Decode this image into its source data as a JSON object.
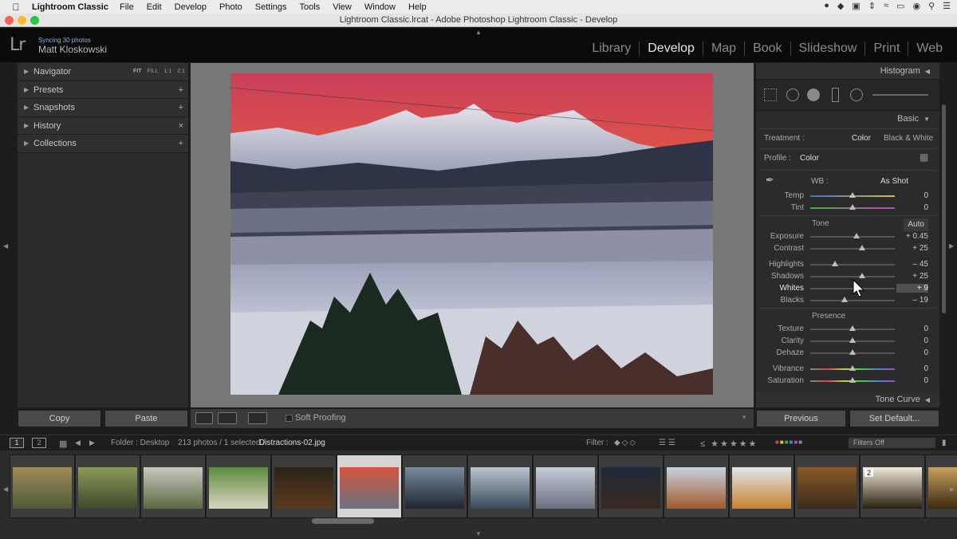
{
  "menubar": {
    "app_name": "Lightroom Classic",
    "items": [
      "File",
      "Edit",
      "Develop",
      "Photo",
      "Settings",
      "Tools",
      "View",
      "Window",
      "Help"
    ]
  },
  "window": {
    "title": "Lightroom Classic.lrcat - Adobe Photoshop Lightroom Classic - Develop"
  },
  "identity": {
    "logo": "Lr",
    "sync_status": "Syncing 30 photos",
    "user": "Matt Kloskowski"
  },
  "modules": {
    "items": [
      "Library",
      "Develop",
      "Map",
      "Book",
      "Slideshow",
      "Print",
      "Web"
    ],
    "active": "Develop"
  },
  "left_panel": {
    "navigator": {
      "label": "Navigator",
      "zoom": [
        "FIT",
        "FILL",
        "1:1",
        "2:1"
      ]
    },
    "presets": {
      "label": "Presets",
      "action": "+"
    },
    "snapshots": {
      "label": "Snapshots",
      "action": "+"
    },
    "history": {
      "label": "History",
      "action": "×"
    },
    "collections": {
      "label": "Collections",
      "action": "+"
    },
    "copy_label": "Copy",
    "paste_label": "Paste"
  },
  "toolbar": {
    "soft_proofing": "Soft Proofing"
  },
  "right_panel": {
    "histogram_label": "Histogram",
    "basic_label": "Basic",
    "treatment_label": "Treatment :",
    "treatment_color": "Color",
    "treatment_bw": "Black & White",
    "profile_label": "Profile :",
    "profile_value": "Color",
    "wb_label": "WB :",
    "wb_value": "As Shot",
    "tone_label": "Tone",
    "auto_label": "Auto",
    "presence_label": "Presence",
    "tone_curve_label": "Tone Curve",
    "wb_sliders": [
      {
        "label": "Temp",
        "value": "0",
        "pos": 0.5
      },
      {
        "label": "Tint",
        "value": "0",
        "pos": 0.5
      }
    ],
    "tone_sliders": [
      {
        "label": "Exposure",
        "value": "+ 0.45",
        "pos": 0.55
      },
      {
        "label": "Contrast",
        "value": "+ 25",
        "pos": 0.61
      }
    ],
    "tone_sliders_2": [
      {
        "label": "Highlights",
        "value": "– 45",
        "pos": 0.29
      },
      {
        "label": "Shadows",
        "value": "+ 25",
        "pos": 0.61
      },
      {
        "label": "Whites",
        "value": "+ 9",
        "pos": 0.55,
        "active": true
      },
      {
        "label": "Blacks",
        "value": "– 19",
        "pos": 0.41
      }
    ],
    "presence_sliders": [
      {
        "label": "Texture",
        "value": "0",
        "pos": 0.5
      },
      {
        "label": "Clarity",
        "value": "0",
        "pos": 0.5
      },
      {
        "label": "Dehaze",
        "value": "0",
        "pos": 0.5
      }
    ],
    "presence_sliders_2": [
      {
        "label": "Vibrance",
        "value": "0",
        "pos": 0.5
      },
      {
        "label": "Saturation",
        "value": "0",
        "pos": 0.5
      }
    ],
    "previous_label": "Previous",
    "set_default_label": "Set Default..."
  },
  "filmstrip_bar": {
    "screen1": "1",
    "screen2": "2",
    "folder": "Folder : Desktop",
    "count": "213 photos / 1 selected /",
    "filename": "Distractions-02.jpg",
    "filter_label": "Filter :",
    "filters_off": "Filters Off"
  },
  "filmstrip": {
    "thumbs": [
      {
        "colors": [
          "#a08a5a",
          "#4e5a36"
        ]
      },
      {
        "colors": [
          "#8a9a5a",
          "#3d4a2a"
        ]
      },
      {
        "colors": [
          "#c8c8c0",
          "#5a6a40"
        ]
      },
      {
        "colors": [
          "#5e8a3e",
          "#d9d4c0"
        ]
      },
      {
        "colors": [
          "#2a2418",
          "#5c3a1c"
        ]
      },
      {
        "colors": [
          "#d6543e",
          "#6a7282"
        ]
      },
      {
        "colors": [
          "#7a8aa0",
          "#1e2530"
        ]
      },
      {
        "colors": [
          "#b8c4d0",
          "#3a4a5a"
        ]
      },
      {
        "colors": [
          "#c4ccd8",
          "#6a7080"
        ]
      },
      {
        "colors": [
          "#1e2a3a",
          "#3a2a20"
        ]
      },
      {
        "colors": [
          "#c8d2e0",
          "#a05a2a"
        ]
      },
      {
        "colors": [
          "#e0e6ec",
          "#c8802a"
        ]
      },
      {
        "colors": [
          "#8a5a2a",
          "#3a2a1a"
        ]
      },
      {
        "colors": [
          "#f0e8d8",
          "#2a2010"
        ],
        "label": "2"
      },
      {
        "colors": [
          "#c8a060",
          "#3a2a10"
        ]
      }
    ]
  }
}
